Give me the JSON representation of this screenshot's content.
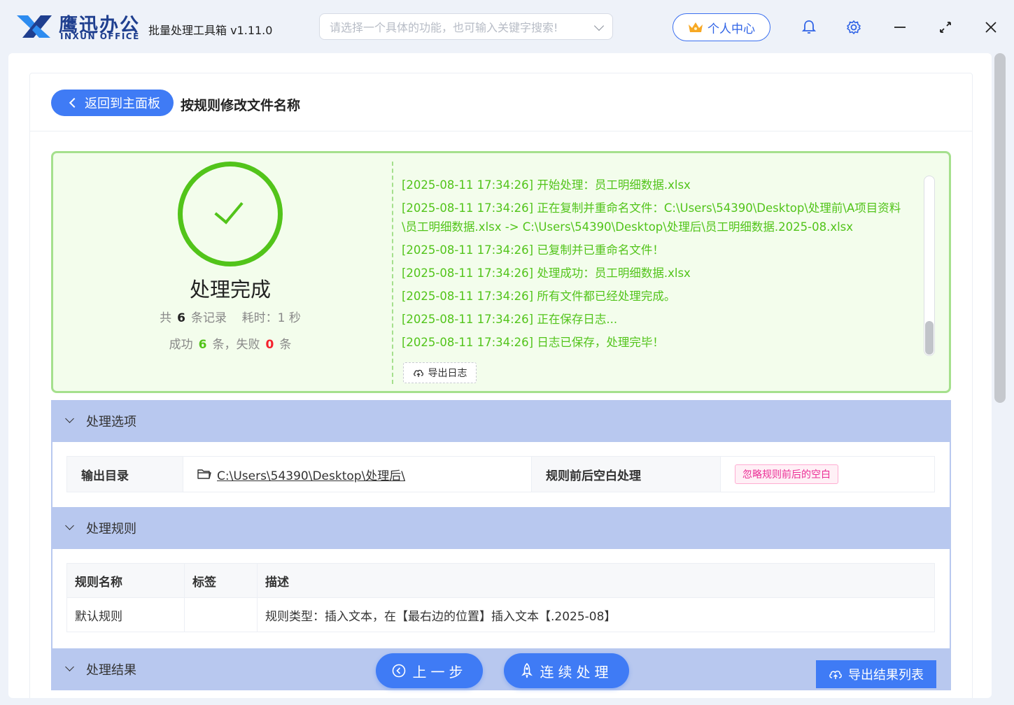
{
  "header": {
    "brand_cn": "鹰迅办公",
    "brand_en": "INXUN OFFICE",
    "app_title": "批量处理工具箱 v1.11.0",
    "search_placeholder": "请选择一个具体的功能，也可输入关键字搜索!",
    "user_center": "个人中心",
    "icons": [
      "crown-icon",
      "bell-icon",
      "gear-icon",
      "minimize-icon",
      "maximize-icon",
      "close-icon"
    ]
  },
  "page": {
    "back_label": "返回到主面板",
    "title": "按规则修改文件名称"
  },
  "result": {
    "title": "处理完成",
    "total_prefix": "共",
    "total_count": "6",
    "total_suffix": "条记录",
    "time_label": "耗时：1 秒",
    "success_prefix": "成功",
    "success_count": "6",
    "success_suffix": "条，失败",
    "fail_count": "0",
    "fail_suffix": "条",
    "export_log": "导出日志",
    "log": [
      "[2025-08-11 17:34:26] 开始处理：员工明细数据.xlsx",
      "[2025-08-11 17:34:26] 正在复制并重命名文件：C:\\Users\\54390\\Desktop\\处理前\\A项目资料\\员工明细数据.xlsx -> C:\\Users\\54390\\Desktop\\处理后\\员工明细数据.2025-08.xlsx",
      "[2025-08-11 17:34:26] 已复制并已重命名文件！",
      "[2025-08-11 17:34:26] 处理成功：员工明细数据.xlsx",
      "[2025-08-11 17:34:26] 所有文件都已经处理完成。",
      "[2025-08-11 17:34:26] 正在保存日志...",
      "[2025-08-11 17:34:26] 日志已保存，处理完毕！"
    ]
  },
  "options": {
    "section_title": "处理选项",
    "output_dir_label": "输出目录",
    "output_dir_value": "C:\\Users\\54390\\Desktop\\处理后\\",
    "whitespace_label": "规则前后空白处理",
    "whitespace_value": "忽略规则前后的空白"
  },
  "rules": {
    "section_title": "处理规则",
    "columns": [
      "规则名称",
      "标签",
      "描述"
    ],
    "rows": [
      [
        "默认规则",
        "",
        "规则类型：插入文本，在【最右边的位置】插入文本【.2025-08】"
      ]
    ]
  },
  "results_section": {
    "section_title": "处理结果"
  },
  "actions": {
    "prev": "上一步",
    "continue": "连续处理",
    "export_results": "导出结果列表"
  },
  "colors": {
    "accent": "#3f7bf5",
    "success": "#52c41a",
    "danger": "#f5222d",
    "section_bg": "#b8c8ef"
  }
}
